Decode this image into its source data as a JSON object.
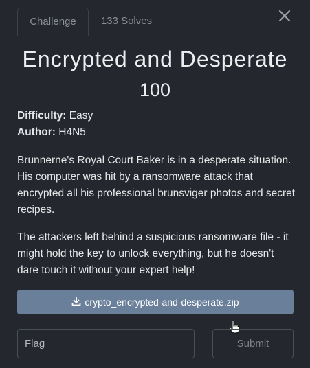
{
  "tabs": [
    {
      "label": "Challenge",
      "active": true
    },
    {
      "label": "133 Solves",
      "active": false
    }
  ],
  "challenge": {
    "title": "Encrypted and Desperate",
    "points": "100",
    "difficulty_label": "Difficulty:",
    "difficulty": "Easy",
    "author_label": "Author:",
    "author": "H4N5",
    "description": [
      "Brunnerne's Royal Court Baker is in a desperate situation. His computer was hit by a ransomware attack that encrypted all his professional brunsviger photos and secret recipes.",
      "The attackers left behind a suspicious ransomware file - it might hold the key to unlock everything, but he doesn't dare touch it without your expert help!"
    ]
  },
  "download": {
    "icon": "download-icon",
    "filename": "crypto_encrypted-and-desperate.zip"
  },
  "form": {
    "flag_placeholder": "Flag",
    "submit_label": "Submit"
  },
  "colors": {
    "background": "#24272d",
    "download_button": "#6a7f99",
    "border": "#4a4e55"
  }
}
